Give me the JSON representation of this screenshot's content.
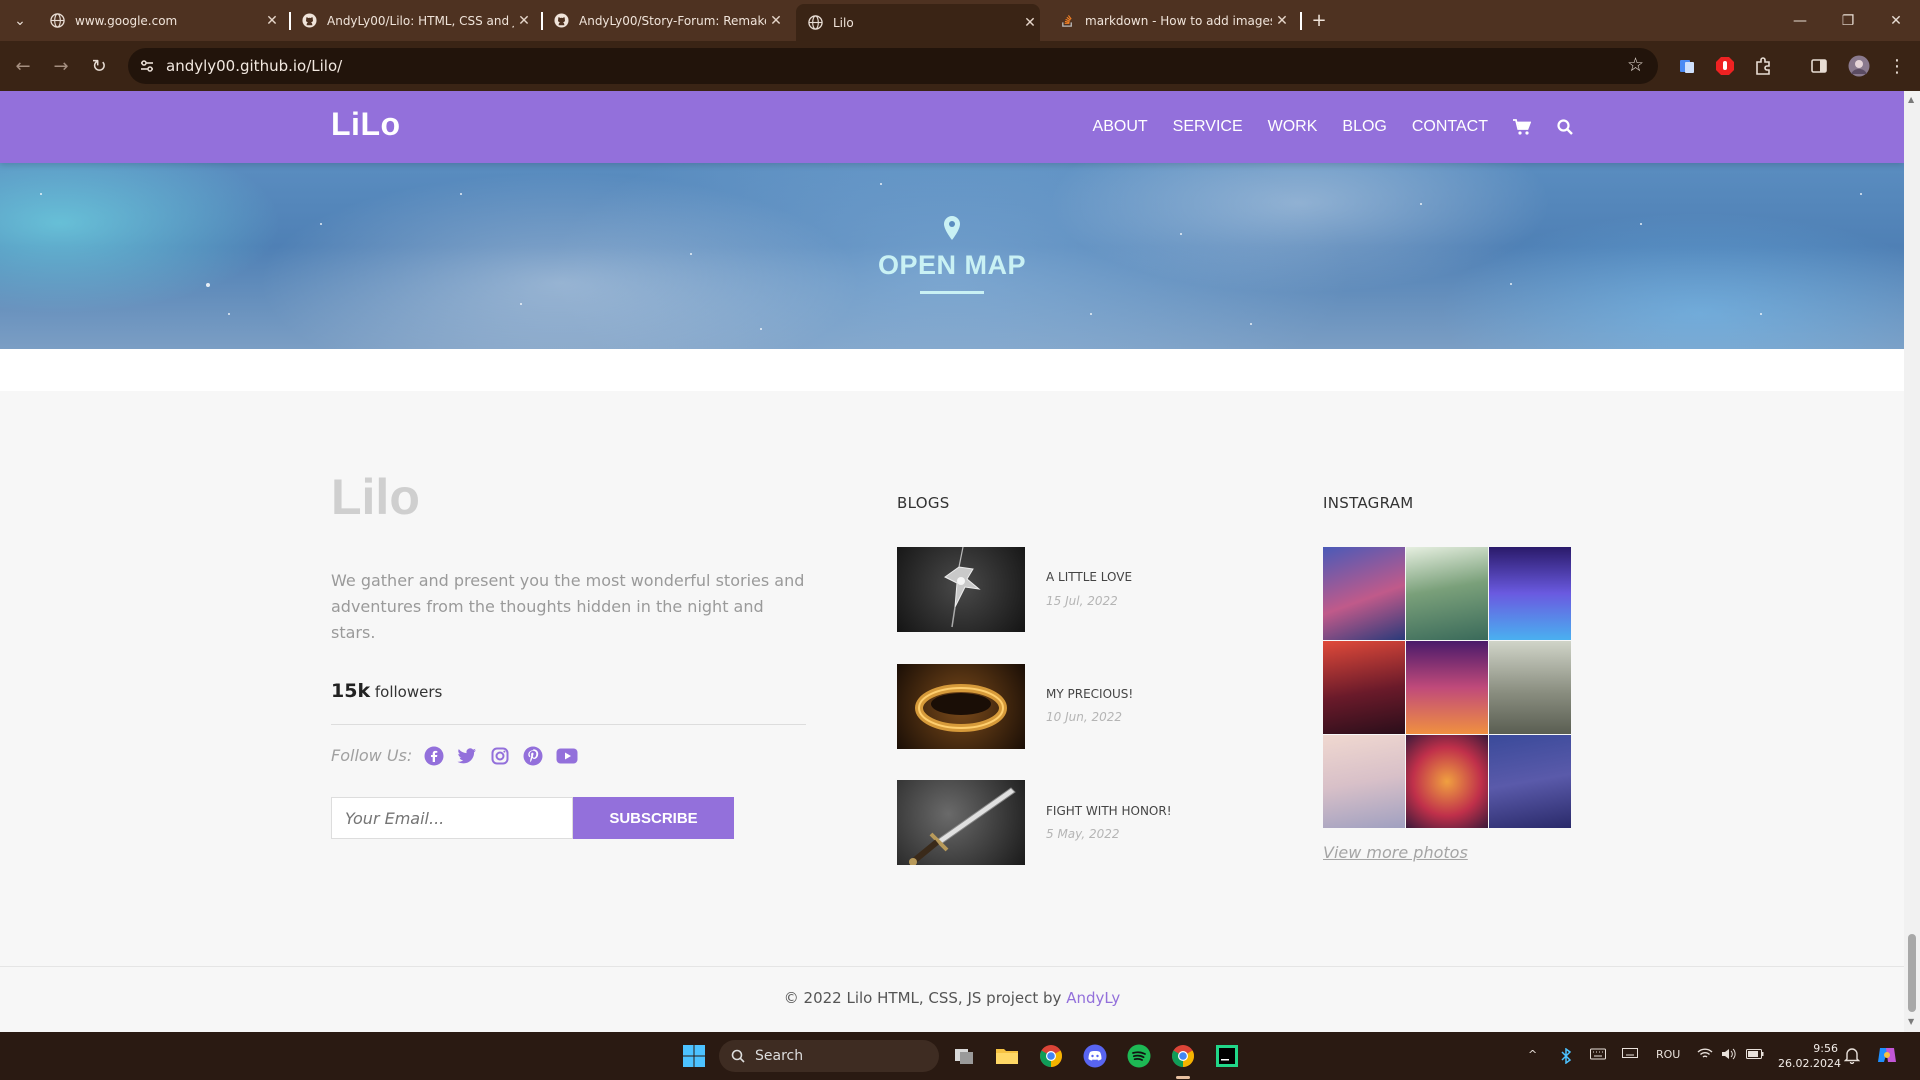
{
  "browser": {
    "tabs": [
      {
        "title": "www.google.com",
        "active": false
      },
      {
        "title": "AndyLy00/Lilo: HTML, CSS and JS p",
        "active": false
      },
      {
        "title": "AndyLy00/Story-Forum: Remake to",
        "active": false
      },
      {
        "title": "Lilo",
        "active": true
      },
      {
        "title": "markdown - How to add images to",
        "active": false
      }
    ],
    "new_tab": "+",
    "url": "andyly00.github.io/Lilo/"
  },
  "site": {
    "logo": "LiLo",
    "menu": [
      "ABOUT",
      "SERVICE",
      "WORK",
      "BLOG",
      "CONTACT"
    ],
    "hero_title": "OPEN MAP"
  },
  "footer": {
    "logo": "Lilo",
    "about": "We gather and present you the most wonderful stories and adventures from the thoughts hidden in the night and stars.",
    "followers_count": "15k",
    "followers_label": "followers",
    "follow_us": "Follow Us:",
    "social": [
      "facebook-icon",
      "twitter-icon",
      "instagram-icon",
      "pinterest-icon",
      "youtube-icon"
    ],
    "email_placeholder": "Your Email...",
    "subscribe": "SUBSCRIBE",
    "blogs_title": "BLOGS",
    "blogs": [
      {
        "title": "A LITTLE LOVE",
        "date": "15 Jul, 2022"
      },
      {
        "title": "MY PRECIOUS!",
        "date": "10 Jun, 2022"
      },
      {
        "title": "FIGHT WITH HONOR!",
        "date": "5 May, 2022"
      }
    ],
    "instagram_title": "INSTAGRAM",
    "view_more": "View more photos",
    "copyright_prefix": "© 2022 Lilo HTML, CSS, JS project by",
    "copyright_author": "AndyLy"
  },
  "taskbar": {
    "search": "Search",
    "language": "ROU",
    "time": "9:56",
    "date": "26.02.2024"
  },
  "colors": {
    "brand": "#9370db",
    "chrome_frame": "#4e3221",
    "chrome_toolbar": "#3a2415"
  }
}
